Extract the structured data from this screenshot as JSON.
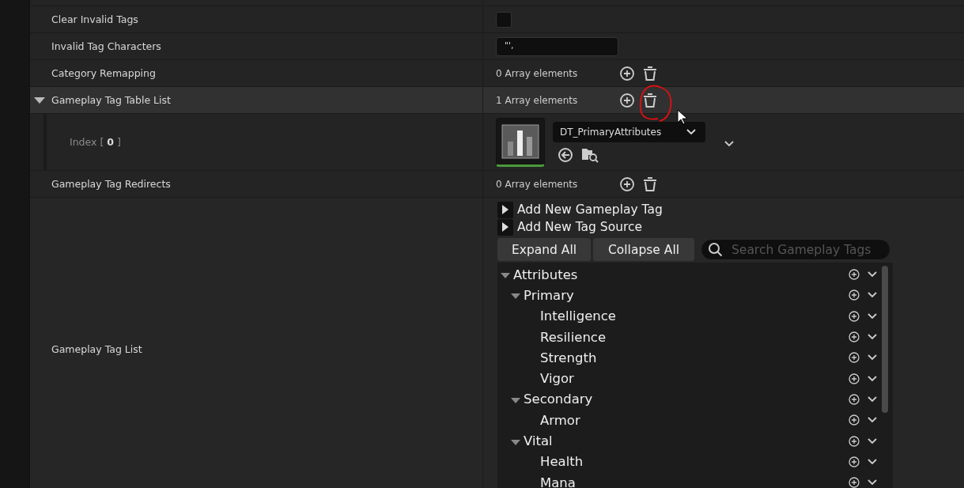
{
  "properties": [
    {
      "kind": "checkbox",
      "label": "Clear Invalid Tags",
      "checked": false
    },
    {
      "kind": "text",
      "label": "Invalid Tag Characters",
      "value": "\"',"
    },
    {
      "kind": "array",
      "label": "Category Remapping",
      "count": "0 Array elements"
    },
    {
      "kind": "array",
      "label": "Gameplay Tag Table List",
      "count": "1 Array elements",
      "expanded": true,
      "highlighted": true
    },
    {
      "kind": "asset",
      "label": "Index [ **0** ]",
      "asset": "DT_PrimaryAttributes"
    },
    {
      "kind": "array",
      "label": "Gameplay Tag Redirects",
      "count": "0 Array elements"
    }
  ],
  "tag_list": {
    "label": "Gameplay Tag List",
    "add_sections": [
      {
        "label": "Add New Gameplay Tag",
        "expanded": false
      },
      {
        "label": "Add New Tag Source",
        "expanded": false
      }
    ],
    "buttons": [
      "Expand All",
      "Collapse All"
    ],
    "search": {
      "placeholder": "Search Gameplay Tags"
    },
    "tree": [
      {
        "label": "Attributes",
        "expanded": true,
        "children": [
          {
            "label": "Primary",
            "expanded": true,
            "children": [
              {
                "label": "Intelligence"
              },
              {
                "label": "Resilience"
              },
              {
                "label": "Strength"
              },
              {
                "label": "Vigor"
              }
            ]
          },
          {
            "label": "Secondary",
            "expanded": true,
            "children": [
              {
                "label": "Armor"
              }
            ]
          },
          {
            "label": "Vital",
            "expanded": true,
            "children": [
              {
                "label": "Health"
              },
              {
                "label": "Mana"
              }
            ]
          }
        ]
      }
    ]
  }
}
